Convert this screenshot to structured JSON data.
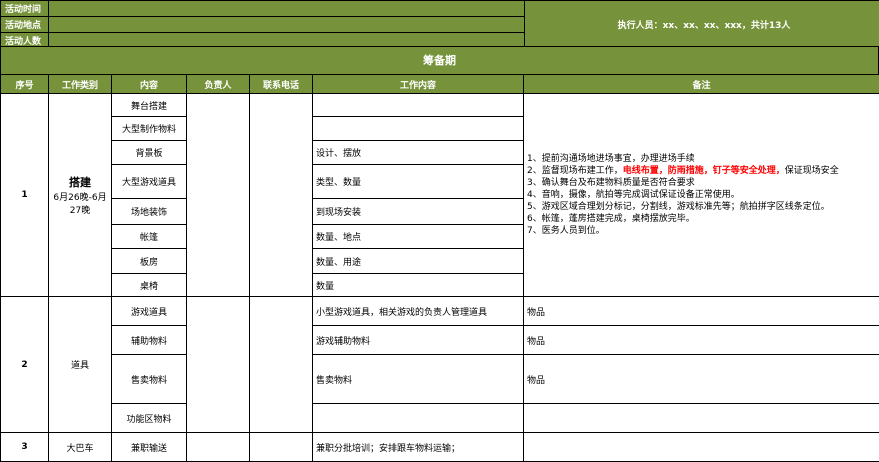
{
  "top": {
    "label_time": "活动时间",
    "label_place": "活动地点",
    "label_count": "活动人数",
    "executor": "执行人员：xx、xx、xx、xxx，共计13人"
  },
  "banner": "筹备期",
  "headers": [
    "序号",
    "工作类别",
    "内容",
    "负责人",
    "联系电话",
    "工作内容",
    "备注"
  ],
  "group1": {
    "no": "1",
    "category": "搭建",
    "date": "6月26晚-6月27晚",
    "rows": [
      {
        "content": "舞台搭建",
        "work": ""
      },
      {
        "content": "大型制作物料",
        "work": ""
      },
      {
        "content": "背景板",
        "work": "设计、摆放"
      },
      {
        "content": "大型游戏道具",
        "work": "类型、数量"
      },
      {
        "content": "场地装饰",
        "work": "到现场安装"
      },
      {
        "content": "帐篷",
        "work": "数量、地点"
      },
      {
        "content": "板房",
        "work": "数量、用途"
      },
      {
        "content": "桌椅",
        "work": "数量"
      }
    ],
    "remarks": {
      "r1": "1、提前沟通场地进场事宜，办理进场手续",
      "r2_a": "2、监督现场布建工作，",
      "r2_red": "电线布置，防雨措施，钉子等安全处理，",
      "r2_b": "保证现场安全",
      "r3": "3、确认舞台及布建物料质量是否符合要求",
      "r4": "4、音响，摄像，航拍等完成调试保证设备正常使用。",
      "r5": "5、游戏区域合理划分标记，分割线，游戏标准先等；航拍拼字区线条定位。",
      "r6": "6、帐篷，蓬房搭建完成，桌椅摆放完毕。",
      "r7": "7、医务人员到位。"
    }
  },
  "group2": {
    "no": "2",
    "category": "道具",
    "rows": [
      {
        "content": "游戏道具",
        "work": "小型游戏道具，相关游戏的负责人管理道具",
        "remark": "物品"
      },
      {
        "content": "辅助物料",
        "work": "游戏辅助物料",
        "remark": "物品"
      },
      {
        "content": "售卖物料",
        "work": "售卖物料",
        "remark": "物品"
      },
      {
        "content": "功能区物料",
        "work": "",
        "remark": ""
      }
    ]
  },
  "group3": {
    "no": "3",
    "category": "大巴车",
    "content": "兼职输送",
    "work": "兼职分批培训；安排跟车物料运输；"
  }
}
